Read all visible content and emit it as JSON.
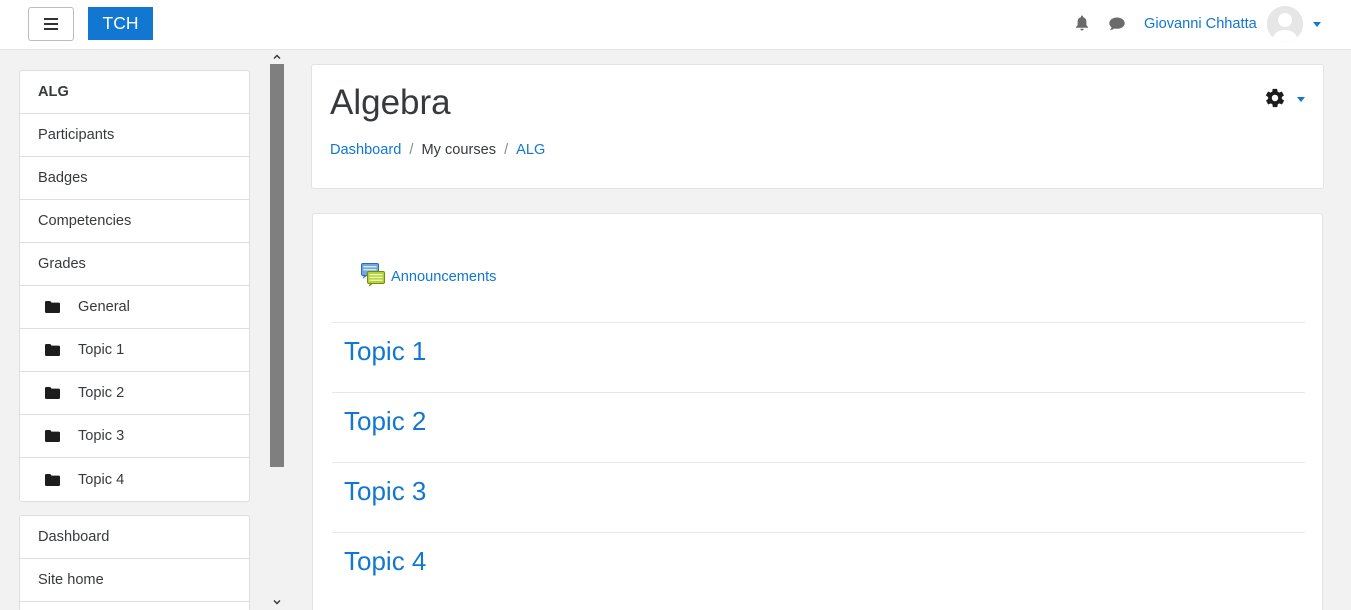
{
  "navbar": {
    "brand": "TCH",
    "user_name": "Giovanni Chhatta",
    "icons": [
      "menu-icon",
      "bell-icon",
      "chat-icon",
      "avatar",
      "chevron-down-icon"
    ]
  },
  "drawer": {
    "course_items": [
      {
        "label": "ALG"
      },
      {
        "label": "Participants"
      },
      {
        "label": "Badges"
      },
      {
        "label": "Competencies"
      },
      {
        "label": "Grades"
      },
      {
        "label": "General"
      },
      {
        "label": "Topic 1"
      },
      {
        "label": "Topic 2"
      },
      {
        "label": "Topic 3"
      },
      {
        "label": "Topic 4"
      }
    ],
    "site_items": [
      {
        "label": "Dashboard"
      },
      {
        "label": "Site home"
      }
    ]
  },
  "header": {
    "title": "Algebra",
    "breadcrumb": [
      "Dashboard",
      "My courses",
      "ALG"
    ],
    "breadcrumb_sep": "/"
  },
  "content": {
    "announcements": "Announcements",
    "sections": [
      "Topic 1",
      "Topic 2",
      "Topic 3",
      "Topic 4"
    ]
  },
  "colors": {
    "accent": "#1177d1",
    "background": "#f2f2f2",
    "text": "#373a3c"
  }
}
